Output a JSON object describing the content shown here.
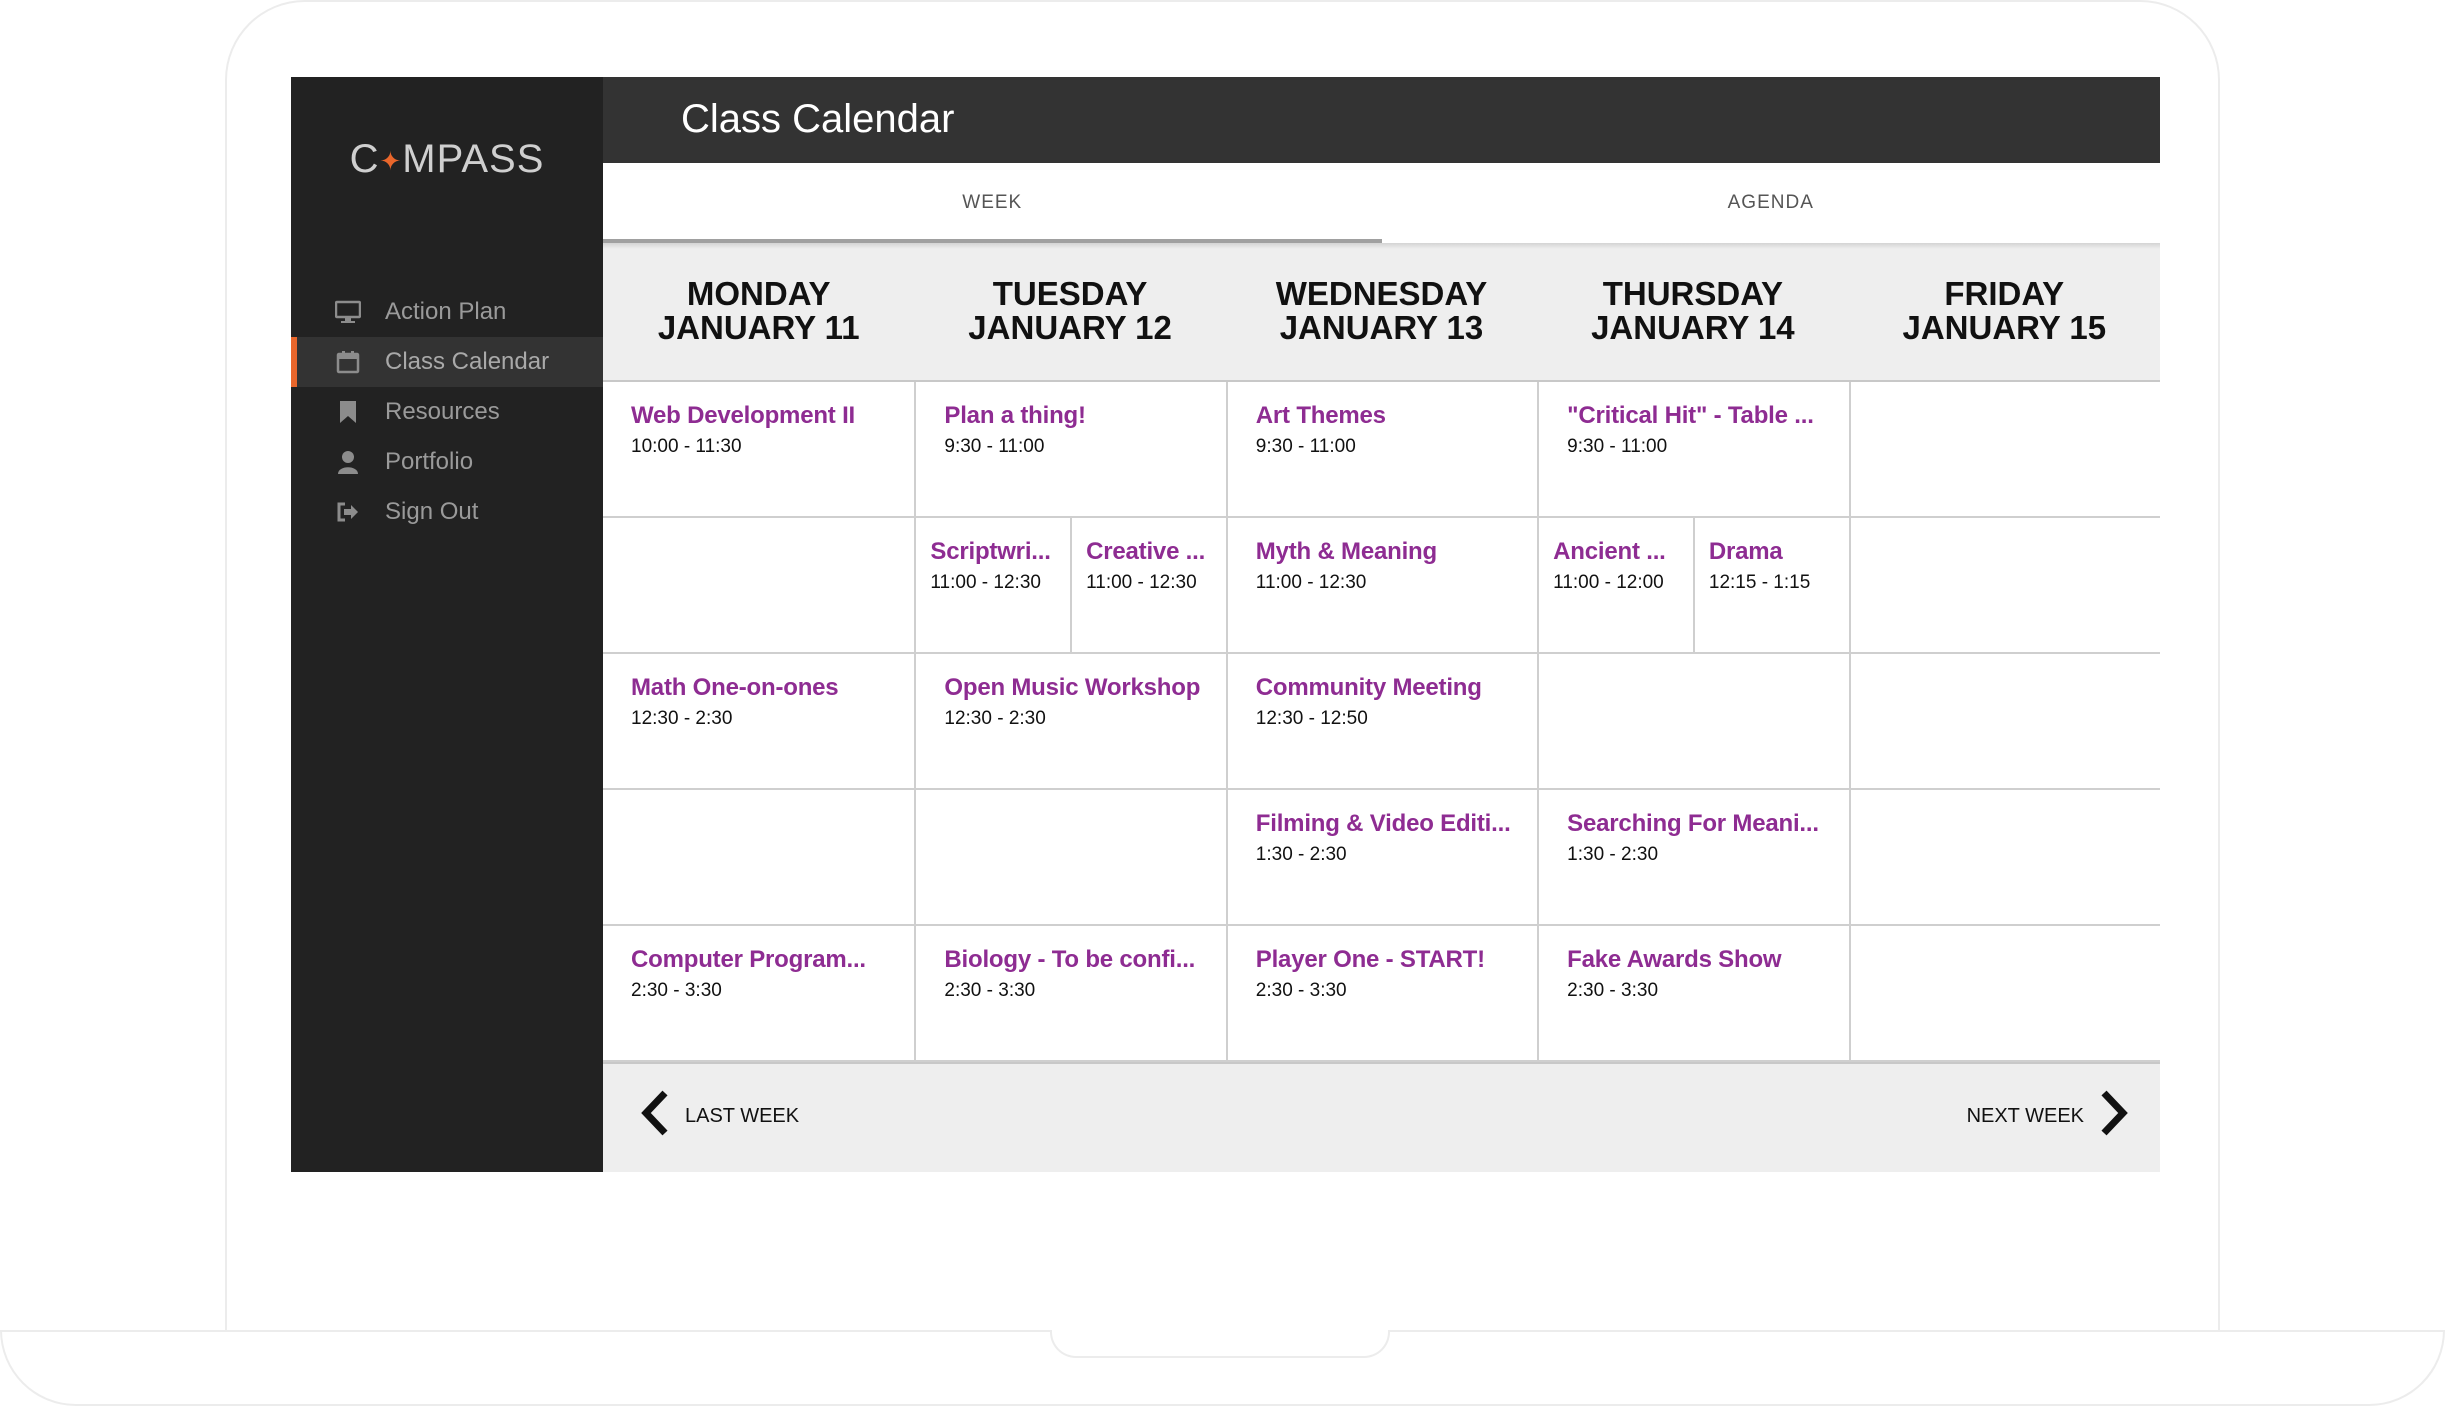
{
  "app": {
    "logo_left": "C",
    "logo_right": "MPASS"
  },
  "sidebar": {
    "items": [
      {
        "label": "Action Plan",
        "icon": "monitor-icon",
        "active": false
      },
      {
        "label": "Class Calendar",
        "icon": "calendar-icon",
        "active": true
      },
      {
        "label": "Resources",
        "icon": "bookmark-icon",
        "active": false
      },
      {
        "label": "Portfolio",
        "icon": "user-icon",
        "active": false
      },
      {
        "label": "Sign Out",
        "icon": "sign-out-icon",
        "active": false
      }
    ]
  },
  "header": {
    "title": "Class Calendar"
  },
  "tabs": [
    {
      "label": "WEEK",
      "active": true
    },
    {
      "label": "AGENDA",
      "active": false
    }
  ],
  "days": [
    {
      "weekday": "MONDAY",
      "date": "JANUARY 11"
    },
    {
      "weekday": "TUESDAY",
      "date": "JANUARY 12"
    },
    {
      "weekday": "WEDNESDAY",
      "date": "JANUARY 13"
    },
    {
      "weekday": "THURSDAY",
      "date": "JANUARY 14"
    },
    {
      "weekday": "FRIDAY",
      "date": "JANUARY 15"
    }
  ],
  "schedule": {
    "monday": {
      "r0": {
        "title": "Web Development II",
        "time": "10:00 - 11:30"
      },
      "r2": {
        "title": "Math One-on-ones",
        "time": "12:30 - 2:30"
      },
      "r4": {
        "title": "Computer Program...",
        "time": "2:30 - 3:30"
      }
    },
    "tuesday": {
      "r0": {
        "title": "Plan a thing!",
        "time": "9:30 - 11:00"
      },
      "r1a": {
        "title": "Scriptwri...",
        "time": "11:00 - 12:30"
      },
      "r1b": {
        "title": "Creative ...",
        "time": "11:00 - 12:30"
      },
      "r2": {
        "title": "Open Music Workshop",
        "time": "12:30 - 2:30"
      },
      "r4": {
        "title": "Biology - To be confi...",
        "time": "2:30 - 3:30"
      }
    },
    "wednesday": {
      "r0": {
        "title": "Art Themes",
        "time": "9:30 - 11:00"
      },
      "r1": {
        "title": "Myth & Meaning",
        "time": "11:00 - 12:30"
      },
      "r2": {
        "title": "Community Meeting",
        "time": "12:30 - 12:50"
      },
      "r3": {
        "title": "Filming & Video Editi...",
        "time": "1:30 - 2:30"
      },
      "r4": {
        "title": "Player One - START!",
        "time": "2:30 - 3:30"
      }
    },
    "thursday": {
      "r0": {
        "title": "\"Critical Hit\" - Table ...",
        "time": "9:30 - 11:00"
      },
      "r1a": {
        "title": "Ancient ...",
        "time": "11:00 - 12:00"
      },
      "r1b": {
        "title": "Drama",
        "time": "12:15 - 1:15"
      },
      "r3": {
        "title": "Searching For Meani...",
        "time": "1:30 - 2:30"
      },
      "r4": {
        "title": "Fake Awards Show",
        "time": "2:30 - 3:30"
      }
    }
  },
  "footer": {
    "prev_label": "LAST WEEK",
    "next_label": "NEXT WEEK"
  },
  "colors": {
    "accent": "#e9662b",
    "event_title": "#8e2c92",
    "sidebar_bg": "#222222",
    "topbar_bg": "#333333"
  }
}
